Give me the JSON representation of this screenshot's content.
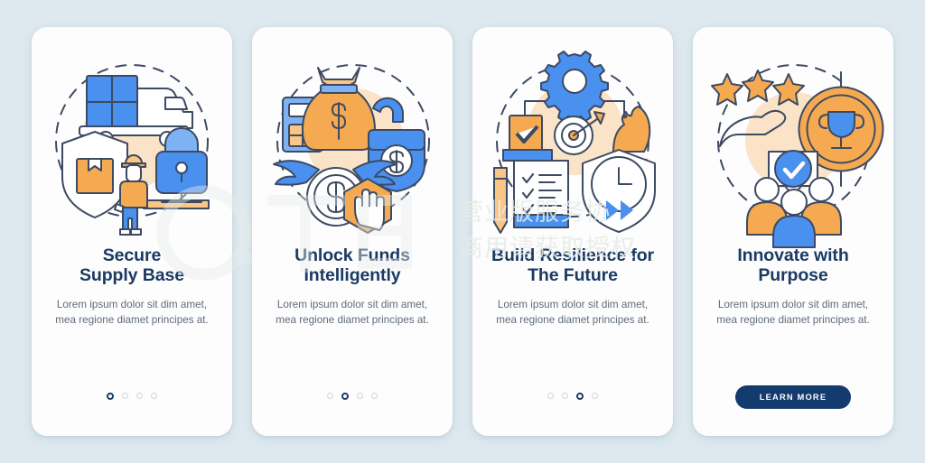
{
  "meta": {
    "background_color": "#dde9ef",
    "card_color": "#fdfdfd",
    "title_color": "#1b3a63",
    "body_color": "#5f6b7a",
    "accent_blue": "#4a90ef",
    "accent_orange": "#f5aa52",
    "accent_peach": "#fae3c6",
    "button_color": "#133b6e"
  },
  "watermark": {
    "logo_text": "千图",
    "line1": "营业版服务协",
    "line2": "商用请获取授权"
  },
  "body_text": "Lorem ipsum dolor sit dim amet, mea regione diamet principes at.",
  "cards": [
    {
      "id": "secure-supply-base",
      "title": "Secure\nSupply Base",
      "title_line1": "Secure",
      "title_line2": "Supply Base",
      "body": "Lorem ipsum dolor sit dim amet, mea regione diamet principes at.",
      "dots_total": 4,
      "dots_active": 1,
      "footer_type": "dots",
      "illustration": {
        "name": "supply-truck-shield-lock-illustration",
        "icons": [
          "delivery-truck-icon",
          "shield-package-icon",
          "worker-person-icon",
          "padlock-icon"
        ]
      }
    },
    {
      "id": "unlock-funds-intelligently",
      "title": "Unlock Funds\nIntelligently",
      "title_line1": "Unlock Funds",
      "title_line2": "Intelligently",
      "body": "Lorem ipsum dolor sit dim amet, mea regione diamet principes at.",
      "dots_total": 4,
      "dots_active": 2,
      "footer_type": "dots",
      "illustration": {
        "name": "money-bag-unlock-illustration",
        "icons": [
          "calculator-icon",
          "money-bag-icon",
          "open-padlock-dollar-icon",
          "winged-coin-icon",
          "stop-hand-icon"
        ]
      }
    },
    {
      "id": "build-resilience-for-the-future",
      "title": "Build Resilience for\nThe Future",
      "title_line1": "Build Resilience for",
      "title_line2": "The Future",
      "body": "Lorem ipsum dolor sit dim amet, mea regione diamet principes at.",
      "dots_total": 4,
      "dots_active": 3,
      "footer_type": "dots",
      "illustration": {
        "name": "strategy-checklist-resilience-illustration",
        "icons": [
          "gear-icon",
          "checkbox-card-icon",
          "target-arrow-icon",
          "chess-knight-icon",
          "checklist-document-icon",
          "pen-icon",
          "shield-clock-fast-forward-icon"
        ]
      }
    },
    {
      "id": "innovate-with-purpose",
      "title": "Innovate with\nPurpose",
      "title_line1": "Innovate with",
      "title_line2": "Purpose",
      "body": "Lorem ipsum dolor sit dim amet, mea regione diamet principes at.",
      "footer_type": "button",
      "button_label": "LEARN MORE",
      "illustration": {
        "name": "team-award-target-illustration",
        "icons": [
          "three-stars-icon",
          "open-hand-icon",
          "trophy-target-icon",
          "verified-check-badge-icon",
          "team-people-icon"
        ]
      }
    }
  ]
}
